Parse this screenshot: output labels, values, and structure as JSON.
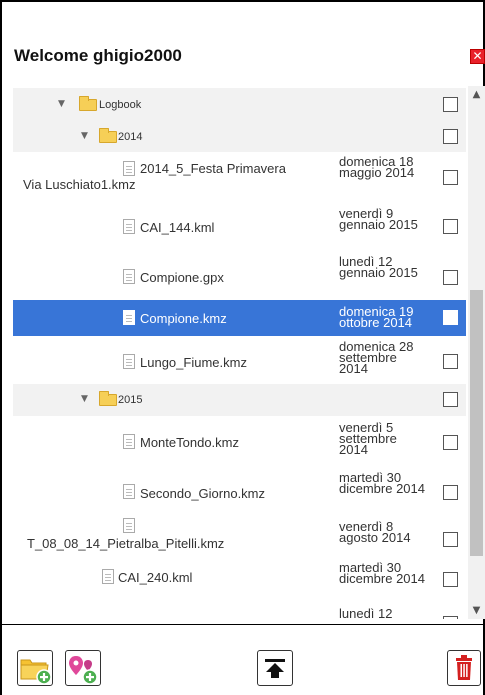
{
  "window": {
    "title": "Welcome ghigio2000"
  },
  "icons": {
    "close": "close-icon",
    "folder": "folder-icon",
    "file": "file-icon",
    "add_folder": "add-folder-icon",
    "add_poi": "add-poi-icon",
    "upload": "upload-icon",
    "delete": "trash-icon",
    "scroll_up": "chevron-up-icon",
    "scroll_down": "chevron-down-icon"
  },
  "colors": {
    "selection": "#3875d7",
    "close": "#e9212a",
    "delete": "#d42020",
    "folder": "#f6cf57",
    "add_green": "#4caf50",
    "poi_pink": "#e0489a"
  },
  "tree": {
    "folder_logbook": "Logbook",
    "folder_2014": "2014",
    "folder_2015": "2015",
    "files": [
      {
        "name_1": "2014_5_Festa Primavera",
        "name_2": "Via Luschiato1.kmz",
        "date": "domenica 18 maggio 2014"
      },
      {
        "name": "CAI_144.kml",
        "date": "venerdì 9 gennaio 2015"
      },
      {
        "name": "Compione.gpx",
        "date": "lunedì 12 gennaio 2015"
      },
      {
        "name": "Compione.kmz",
        "date": "domenica 19 ottobre 2014",
        "selected": true
      },
      {
        "name": "Lungo_Fiume.kmz",
        "date": "domenica 28 settembre 2014"
      },
      {
        "name": "MonteTondo.kmz",
        "date": "venerdì 5 settembre 2014"
      },
      {
        "name": "Secondo_Giorno.kmz",
        "date": "martedì 30 dicembre 2014"
      },
      {
        "name": "T_08_08_14_Pietralba_Pitelli.kmz",
        "date": "venerdì 8 agosto 2014"
      },
      {
        "name": "CAI_240.kml",
        "date": "martedì 30 dicembre 2014"
      },
      {
        "name": "",
        "date": "lunedì 12"
      }
    ]
  }
}
